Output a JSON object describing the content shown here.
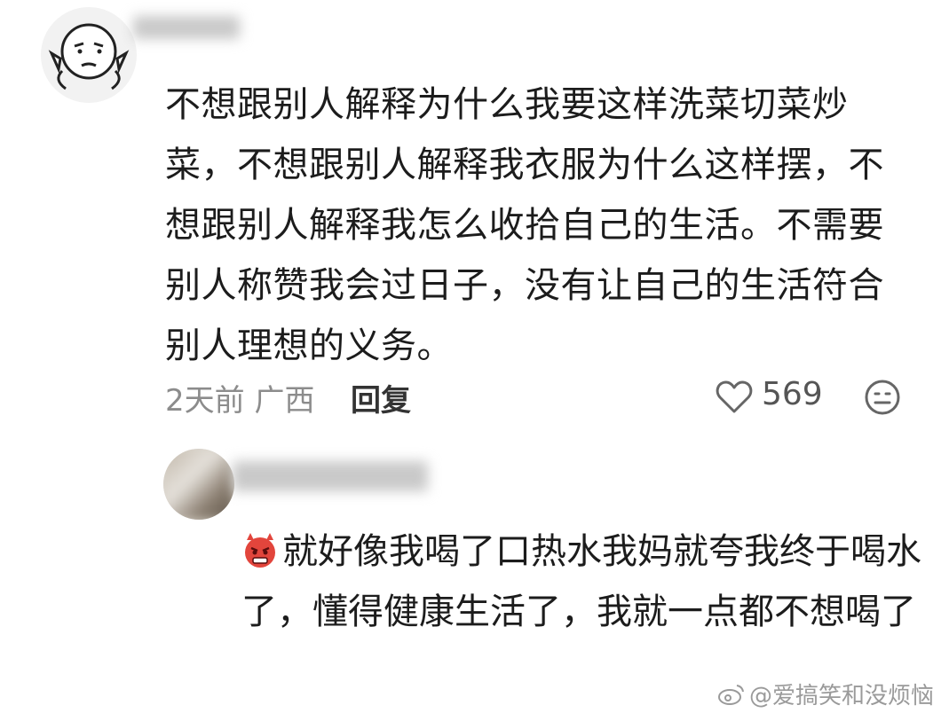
{
  "comment": {
    "text": "不想跟别人解释为什么我要这样洗菜切菜炒菜，不想跟别人解释我衣服为什么这样摆，不想跟别人解释我怎么收拾自己的生活。不需要别人称赞我会过日子，没有让自己的生活符合别人理想的义务。",
    "time_location": "2天前 广西",
    "reply_label": "回复",
    "likes": "569"
  },
  "sub_comment": {
    "text": "就好像我喝了口热水我妈就夸我终于喝水了，懂得健康生活了，我就一点都不想喝了"
  },
  "watermark": {
    "text": "@爱搞笑和没烦恼"
  },
  "icons": {
    "like": "heart-outline-icon",
    "reaction": "smiley-outline-icon",
    "inline_emoji": "angry-devil-emoji",
    "weibo": "weibo-icon"
  },
  "colors": {
    "meta_gray": "#8c8c8c",
    "emoji_red": "#e2453c"
  }
}
